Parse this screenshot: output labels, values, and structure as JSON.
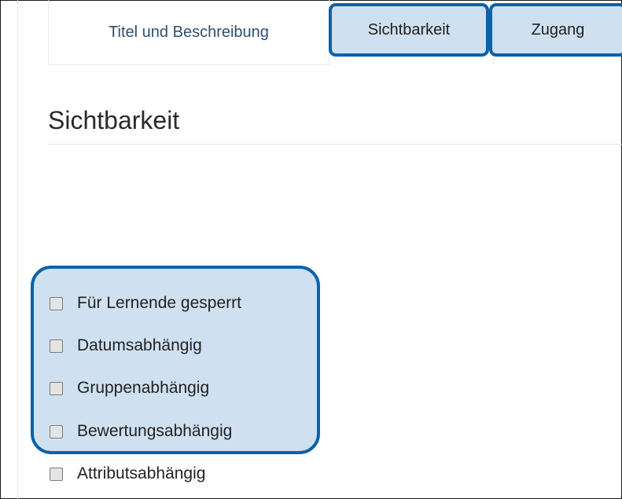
{
  "tabs": [
    {
      "label": "Titel und Beschreibung",
      "highlighted": false
    },
    {
      "label": "Sichtbarkeit",
      "highlighted": true
    },
    {
      "label": "Zugang",
      "highlighted": true
    }
  ],
  "section": {
    "title": "Sichtbarkeit"
  },
  "options": [
    {
      "label": "Für Lernende gesperrt",
      "checked": false,
      "highlighted": true
    },
    {
      "label": "Datumsabhängig",
      "checked": false,
      "highlighted": true
    },
    {
      "label": "Gruppenabhängig",
      "checked": false,
      "highlighted": true
    },
    {
      "label": "Bewertungsabhängig",
      "checked": false,
      "highlighted": true
    },
    {
      "label": "Attributsabhängig",
      "checked": false,
      "highlighted": false
    }
  ],
  "colors": {
    "highlight_fill": "#cfe0f0",
    "highlight_border": "#0d62a8"
  }
}
